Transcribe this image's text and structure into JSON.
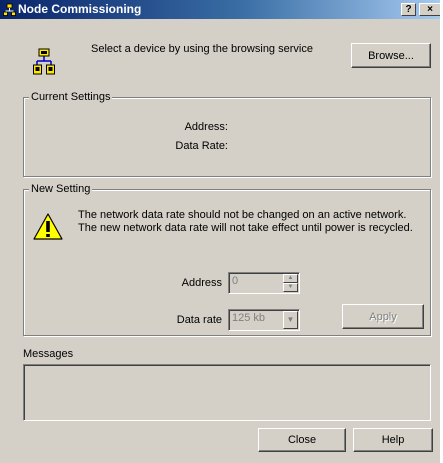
{
  "window": {
    "title": "Node Commissioning",
    "help_button": "?",
    "close_button": "×"
  },
  "browse": {
    "instruction": "Select a device by using the browsing service",
    "button_label": "Browse..."
  },
  "current_settings": {
    "legend": "Current Settings",
    "address_label": "Address:",
    "data_rate_label": "Data Rate:"
  },
  "new_setting": {
    "legend": "New Setting",
    "warning": "The network data rate should not be changed on an active network. The new network data rate will not take effect until power is recycled.",
    "address_label": "Address",
    "address_value": "0",
    "data_rate_label": "Data rate",
    "data_rate_value": "125 kb",
    "apply_label": "Apply"
  },
  "messages": {
    "label": "Messages"
  },
  "footer": {
    "close_label": "Close",
    "help_label": "Help"
  },
  "icons": {
    "title": "network-icon",
    "device": "network-nodes-icon",
    "warning": "warning-icon"
  }
}
